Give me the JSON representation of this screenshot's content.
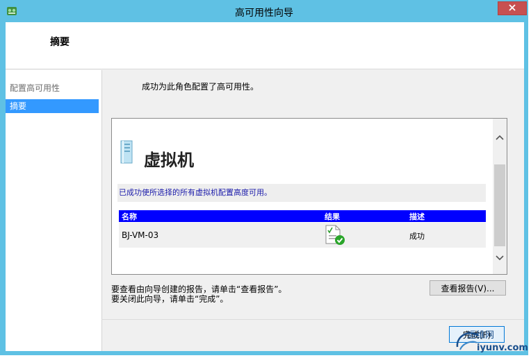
{
  "window": {
    "title": "高可用性向导"
  },
  "header": {
    "title": "摘要"
  },
  "nav": {
    "items": [
      {
        "label": "配置高可用性",
        "active": false
      },
      {
        "label": "摘要",
        "active": true
      }
    ]
  },
  "main": {
    "status": "成功为此角色配置了高可用性。"
  },
  "report": {
    "heading": "虚拟机",
    "message": "已成功使所选择的所有虚拟机配置高度可用。",
    "columns": [
      "名称",
      "结果",
      "描述"
    ],
    "rows": [
      {
        "name": "BJ-VM-03",
        "result_icon": "success-document-icon",
        "description": "成功"
      }
    ]
  },
  "hints": {
    "line1": "要查看由向导创建的报告，请单击“查看报告”。",
    "line2": "要关闭此向导，请单击“完成”。"
  },
  "buttons": {
    "view_report": "查看报告(V)...",
    "finish": "完成(F)"
  },
  "watermark": {
    "top": "运维网",
    "bottom": "iyunv.com"
  },
  "colors": {
    "titlebar": "#5fc1e4",
    "nav_active": "#3399ff",
    "table_header": "#0000ff",
    "close_button": "#c75050"
  }
}
